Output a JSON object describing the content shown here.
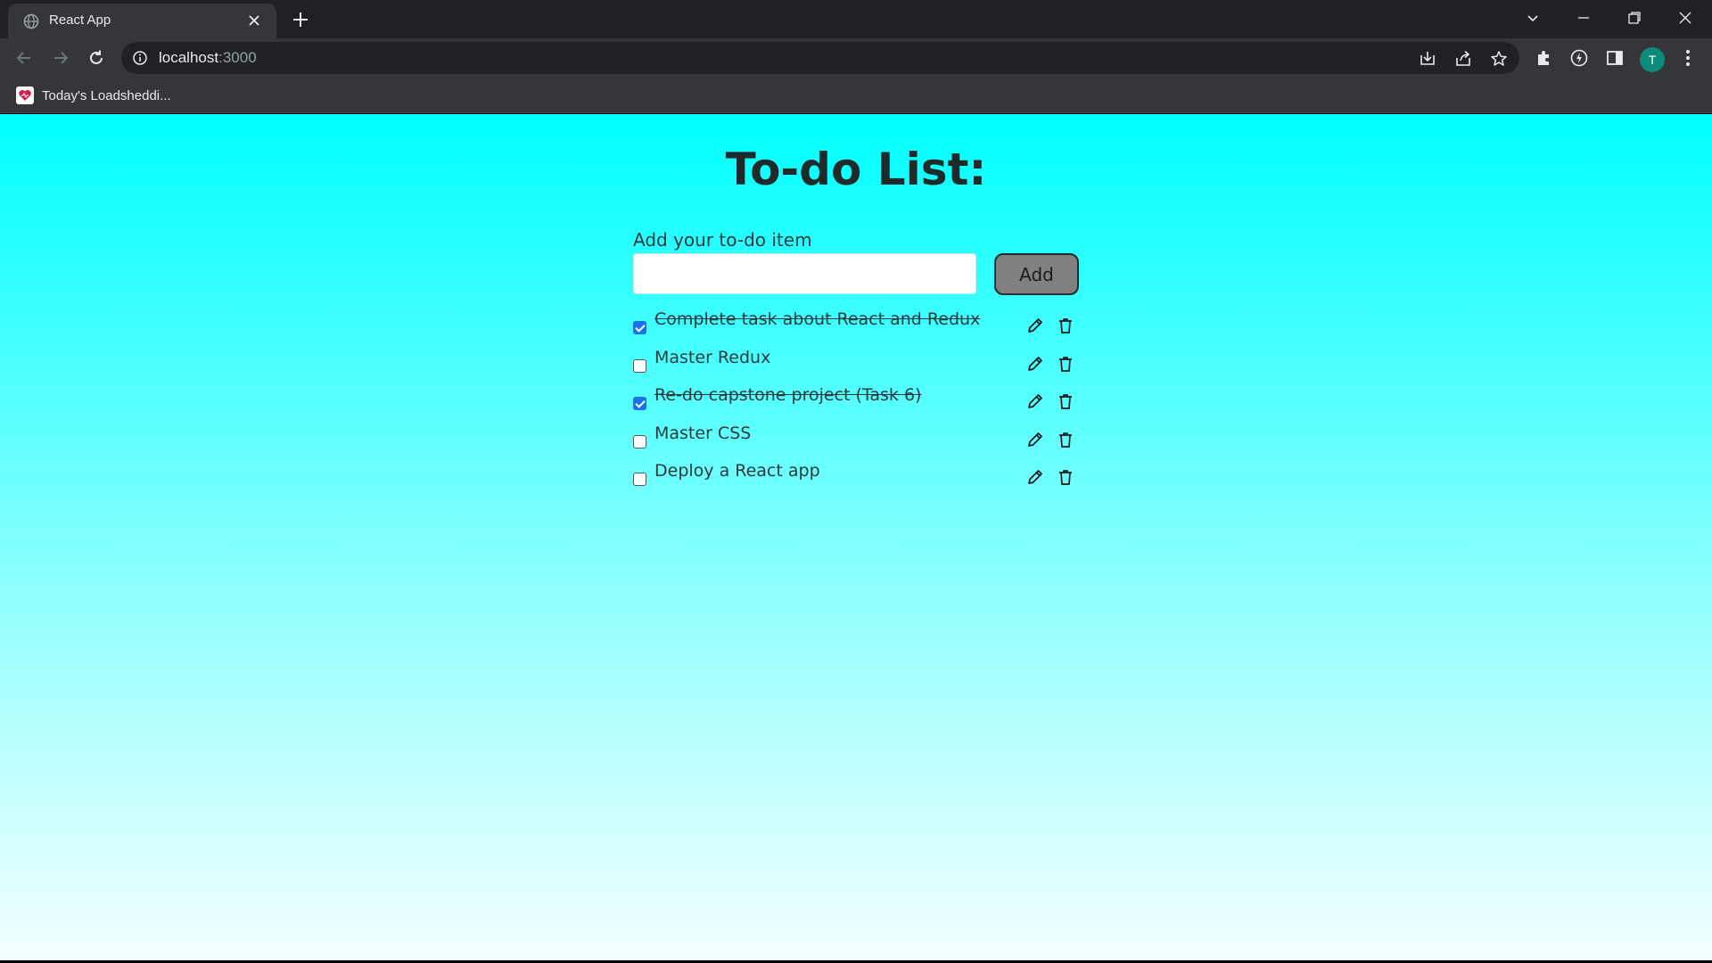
{
  "browser": {
    "tab": {
      "title": "React App",
      "favicon": "globe-icon"
    },
    "address": {
      "host": "localhost",
      "port": ":3000"
    },
    "bookmark": {
      "label": "Today's Loadsheddi...",
      "icon": "heart-icon"
    },
    "profile_initial": "T"
  },
  "app": {
    "title": "To-do List:",
    "input_label": "Add your to-do item",
    "input_value": "",
    "add_button": "Add",
    "todos": [
      {
        "text": "Complete task about React and Redux",
        "completed": true
      },
      {
        "text": "Master Redux",
        "completed": false
      },
      {
        "text": "Re-do capstone project (Task 6)",
        "completed": true
      },
      {
        "text": "Master CSS",
        "completed": false
      },
      {
        "text": "Deploy a React app",
        "completed": false
      }
    ]
  },
  "colors": {
    "gradient_top": "#00ffff",
    "gradient_bottom": "#f4ffff",
    "checkbox_checked": "#1a73e8",
    "add_button_bg": "#808080"
  }
}
